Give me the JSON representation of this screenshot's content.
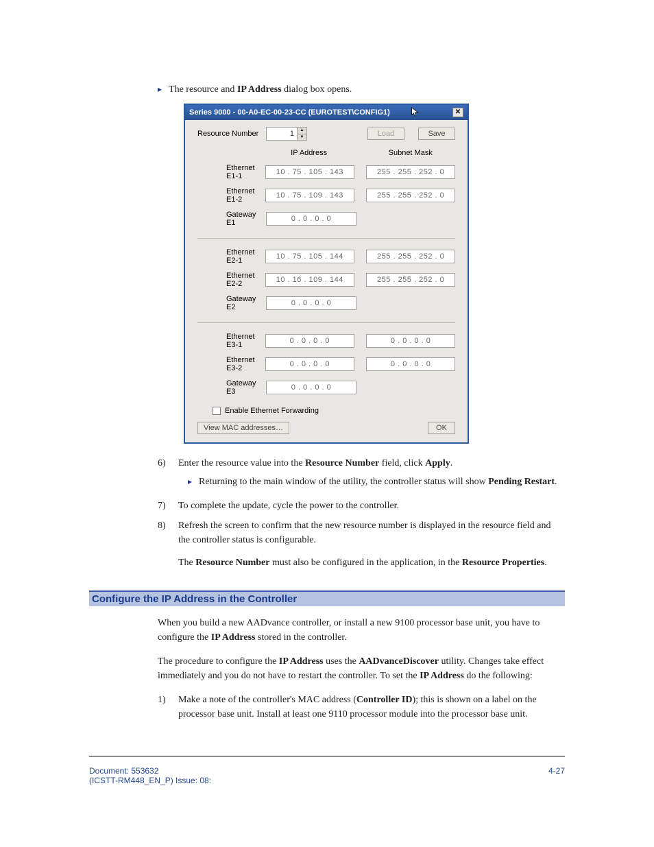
{
  "intro_bullet": {
    "pre": "The resource and ",
    "bold": "IP Address",
    "post": " dialog box opens."
  },
  "dialog": {
    "title": "Series 9000 - 00-A0-EC-00-23-CC (EUROTEST\\CONFIG1)",
    "resource_label": "Resource Number",
    "resource_value": "1",
    "load_btn": "Load",
    "save_btn": "Save",
    "ip_header": "IP Address",
    "mask_header": "Subnet Mask",
    "groups": [
      {
        "rows": [
          {
            "label": "Ethernet E1-1",
            "ip": "10  .  75  . 105  . 143",
            "mask": "255  . 255  . 252  .   0"
          },
          {
            "label": "Ethernet E1-2",
            "ip": "10  .  75  . 109  . 143",
            "mask": "255  . 255  . 252  .   0"
          },
          {
            "label": "Gateway E1",
            "ip": "0   .   0   .   0   .   0",
            "mask": ""
          }
        ]
      },
      {
        "rows": [
          {
            "label": "Ethernet E2-1",
            "ip": "10  .  75  . 105  . 144",
            "mask": "255  . 255  . 252  .   0"
          },
          {
            "label": "Ethernet E2-2",
            "ip": "10  .  16  . 109  . 144",
            "mask": "255  . 255  . 252  .   0"
          },
          {
            "label": "Gateway E2",
            "ip": "0   .   0   .   0   .   0",
            "mask": ""
          }
        ]
      },
      {
        "rows": [
          {
            "label": "Ethernet E3-1",
            "ip": "0   .   0   .   0   .   0",
            "mask": "0   .   0   .   0   .   0"
          },
          {
            "label": "Ethernet E3-2",
            "ip": "0   .   0   .   0   .   0",
            "mask": "0   .   0   .   0   .   0"
          },
          {
            "label": "Gateway E3",
            "ip": "0   .   0   .   0   .   0",
            "mask": ""
          }
        ]
      }
    ],
    "enable_forwarding": "Enable Ethernet Forwarding",
    "view_mac": "View MAC addresses…",
    "ok": "OK"
  },
  "step6": {
    "num": "6)",
    "pre": "Enter the resource value into the ",
    "b1": "Resource Number",
    "mid": " field, click ",
    "b2": "Apply",
    "post": ".",
    "sub_pre": "Returning to the main window of the utility, the controller status will show ",
    "sub_bold": "Pending Restart",
    "sub_post": "."
  },
  "step7": {
    "num": "7)",
    "text": "To complete the update, cycle the power to the controller."
  },
  "step8": {
    "num": "8)",
    "text": "Refresh the screen to confirm that the new resource number is displayed in the resource field and the controller status is configurable.",
    "para_pre": "The ",
    "para_b1": "Resource Number",
    "para_mid": " must also be configured in the application, in the ",
    "para_b2": "Resource Properties",
    "para_post": "."
  },
  "section": {
    "heading": "Configure the IP Address in the Controller",
    "p1": {
      "pre": "When you build a new AADvance controller, or install a new 9100 processor base unit, you have to configure the ",
      "b": "IP Address",
      "post": " stored in the controller."
    },
    "p2": {
      "pre": "The procedure to configure the ",
      "b1": "IP Address",
      "mid1": " uses the ",
      "b2": "AADvanceDiscover",
      "mid2": " utility. Changes take effect immediately and you do not have to restart the controller. To set the ",
      "b3": "IP Address",
      "post": " do the following:"
    },
    "step1": {
      "num": "1)",
      "pre": "Make a note of the controller's MAC address (",
      "b": "Controller ID",
      "post": "); this is shown on a label on the processor base unit. Install at least one 9110 processor module into the processor base unit."
    }
  },
  "footer": {
    "doc_line1": "Document: 553632",
    "doc_line2": "(ICSTT-RM448_EN_P) Issue: 08:",
    "page": "4-27"
  }
}
